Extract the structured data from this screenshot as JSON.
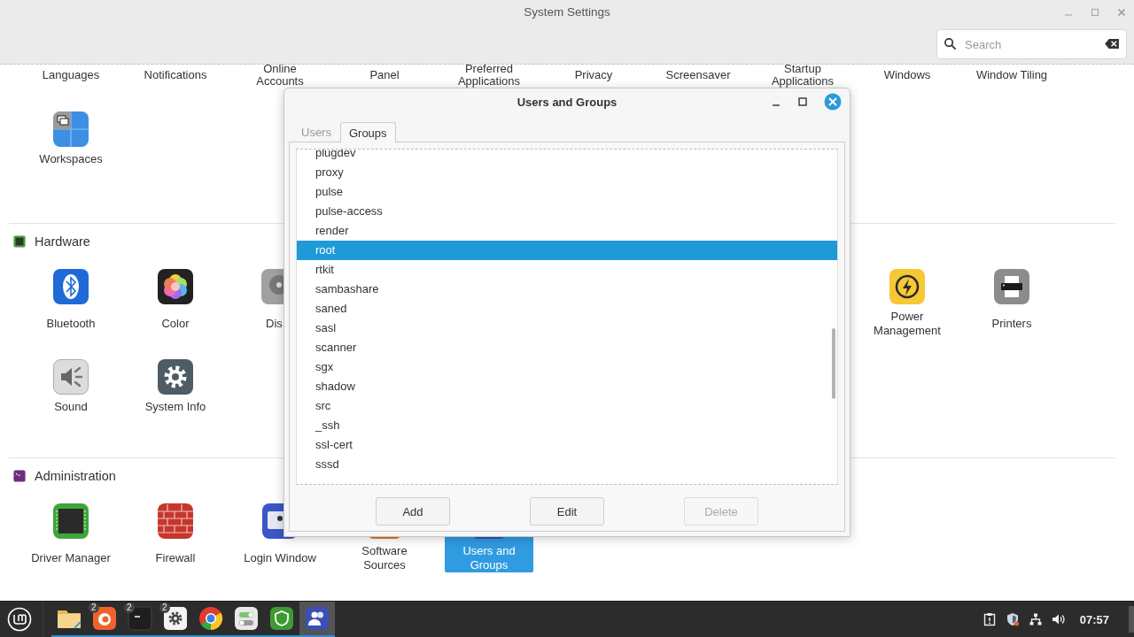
{
  "window": {
    "title": "System Settings"
  },
  "search": {
    "placeholder": "Search"
  },
  "preferences": {
    "cut_labels": [
      "Languages",
      "Notifications",
      "Online Accounts",
      "Panel",
      "Preferred Applications",
      "Privacy",
      "Screensaver",
      "Startup Applications",
      "Windows",
      "Window Tiling"
    ],
    "items": [
      {
        "label": "Workspaces",
        "kind": "workspaces",
        "selected": false
      }
    ]
  },
  "sections": [
    {
      "title": "Hardware",
      "kind": "hardware",
      "rows": [
        {
          "left": [
            {
              "label": "Bluetooth",
              "kind": "bluetooth",
              "selected": false
            },
            {
              "label": "Color",
              "kind": "color",
              "selected": false
            },
            {
              "label": "Dis",
              "kind": "disk",
              "selected": false,
              "clipped": true
            }
          ],
          "right": [
            {
              "label": "Power Management",
              "kind": "power",
              "selected": false
            },
            {
              "label": "Printers",
              "kind": "printer",
              "selected": false
            }
          ]
        },
        {
          "left": [
            {
              "label": "Sound",
              "kind": "sound",
              "selected": false
            },
            {
              "label": "System Info",
              "kind": "sysinfo",
              "selected": false
            }
          ]
        }
      ]
    },
    {
      "title": "Administration",
      "kind": "admin",
      "rows": [
        {
          "left": [
            {
              "label": "Driver Manager",
              "kind": "driver",
              "selected": false
            },
            {
              "label": "Firewall",
              "kind": "firewall",
              "selected": false
            },
            {
              "label": "Login Window",
              "kind": "login",
              "selected": false
            },
            {
              "label": "Software Sources",
              "kind": "software",
              "selected": false
            },
            {
              "label": "Users and Groups",
              "kind": "users",
              "selected": true
            }
          ]
        }
      ]
    }
  ],
  "dialog": {
    "title": "Users and Groups",
    "tabs": [
      {
        "label": "Users",
        "selected": false
      },
      {
        "label": "Groups",
        "selected": true
      }
    ],
    "groups": [
      {
        "name": "plugdev",
        "selected": false
      },
      {
        "name": "proxy",
        "selected": false
      },
      {
        "name": "pulse",
        "selected": false
      },
      {
        "name": "pulse-access",
        "selected": false
      },
      {
        "name": "render",
        "selected": false
      },
      {
        "name": "root",
        "selected": true
      },
      {
        "name": "rtkit",
        "selected": false
      },
      {
        "name": "sambashare",
        "selected": false
      },
      {
        "name": "saned",
        "selected": false
      },
      {
        "name": "sasl",
        "selected": false
      },
      {
        "name": "scanner",
        "selected": false
      },
      {
        "name": "sgx",
        "selected": false
      },
      {
        "name": "shadow",
        "selected": false
      },
      {
        "name": "src",
        "selected": false
      },
      {
        "name": "_ssh",
        "selected": false
      },
      {
        "name": "ssl-cert",
        "selected": false
      },
      {
        "name": "sssd",
        "selected": false
      }
    ],
    "buttons": [
      {
        "label": "Add",
        "disabled": false
      },
      {
        "label": "Edit",
        "disabled": false
      },
      {
        "label": "Delete",
        "disabled": true
      }
    ]
  },
  "taskbar": {
    "launchers": [
      {
        "kind": "folder",
        "running": true,
        "selected": false
      },
      {
        "kind": "firefox",
        "badge": "2",
        "running": true,
        "selected": false
      },
      {
        "kind": "terminal",
        "badge": "2",
        "running": true,
        "selected": false
      },
      {
        "kind": "settings",
        "badge": "2",
        "running": true,
        "selected": false
      },
      {
        "kind": "chrome",
        "running": true,
        "selected": false
      },
      {
        "kind": "toggles",
        "running": true,
        "selected": false
      },
      {
        "kind": "shield",
        "running": true,
        "selected": false
      },
      {
        "kind": "users",
        "running": true,
        "selected": true
      }
    ],
    "clock": "07:57"
  }
}
